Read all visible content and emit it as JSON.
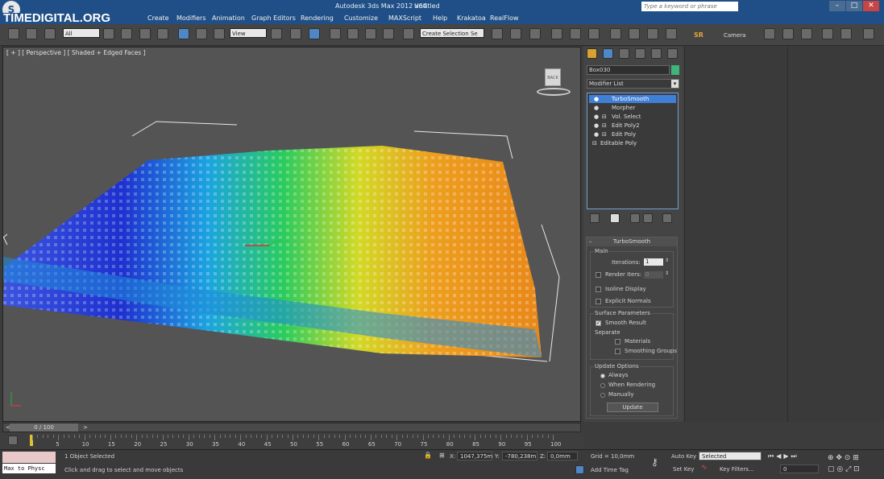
{
  "titlebar": {
    "watermark": "TIMEDIGITAL.ORG",
    "app_title": "Autodesk 3ds Max  2012 x64",
    "doc_title": "Untitled",
    "search_placeholder": "Type a keyword or phrase"
  },
  "menu": {
    "items": [
      "Create",
      "Modifiers",
      "Animation",
      "Graph Editors",
      "Rendering",
      "Customize",
      "MAXScript",
      "Help",
      "Krakatoa",
      "RealFlow"
    ]
  },
  "toolbar": {
    "selection_filter": "All",
    "ref_coord": "View",
    "named_selection": "Create Selection Se",
    "sr_label": "SR",
    "camera_label": "Camera"
  },
  "viewport": {
    "label": "[ + ] [ Perspective ] [ Shaded + Edged Faces ]",
    "viewcube_label": "BACK"
  },
  "command_panel": {
    "object_name": "Box030",
    "object_color": "#3fb57a",
    "modifier_list_label": "Modifier List",
    "stack": [
      {
        "label": "TurboSmooth",
        "selected": true
      },
      {
        "label": "Morpher",
        "selected": false
      },
      {
        "label": "Vol. Select",
        "selected": false
      },
      {
        "label": "Edit Poly2",
        "selected": false
      },
      {
        "label": "Edit Poly",
        "selected": false
      },
      {
        "label": "Editable Poly",
        "selected": false
      }
    ],
    "rollout": {
      "title": "TurboSmooth",
      "main_group": "Main",
      "iterations_label": "Iterations:",
      "iterations_value": "1",
      "render_iters_label": "Render Iters:",
      "render_iters_value": "0",
      "isoline_label": "Isoline Display",
      "explicit_normals_label": "Explicit Normals",
      "surface_group": "Surface Parameters",
      "smooth_result_label": "Smooth Result",
      "separate_label": "Separate",
      "materials_label": "Materials",
      "smoothing_groups_label": "Smoothing Groups",
      "update_group": "Update Options",
      "always_label": "Always",
      "when_rendering_label": "When Rendering",
      "manually_label": "Manually",
      "update_button": "Update"
    }
  },
  "timeline": {
    "frame_label": "0 / 100",
    "ticks": [
      "5",
      "10",
      "15",
      "20",
      "25",
      "30",
      "35",
      "40",
      "45",
      "50",
      "55",
      "60",
      "65",
      "70",
      "75",
      "80",
      "85",
      "90",
      "95",
      "100"
    ]
  },
  "status": {
    "script_listener": "Max to Physc",
    "objects_selected": "1 Object Selected",
    "prompt": "Click and drag to select and move objects",
    "x_label": "X:",
    "x_value": "1047,375m",
    "y_label": "Y:",
    "y_value": "-780,238m",
    "z_label": "Z:",
    "z_value": "0,0mm",
    "grid": "Grid = 10,0mm",
    "add_time_tag": "Add Time Tag",
    "auto_key": "Auto Key",
    "set_key": "Set Key",
    "key_mode": "Selected",
    "key_filters": "Key Filters...",
    "current_frame": "0"
  }
}
